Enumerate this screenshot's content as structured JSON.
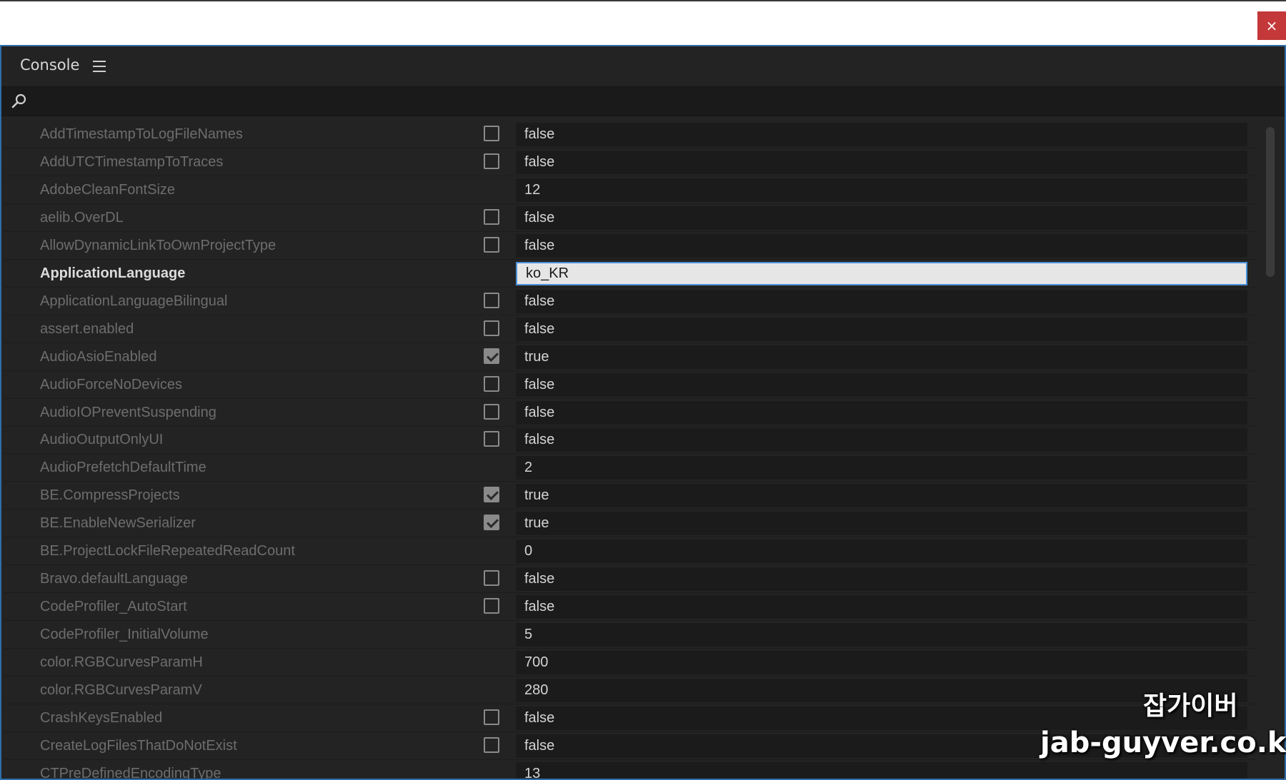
{
  "window": {
    "close_label": "×"
  },
  "panel": {
    "title": "Console"
  },
  "search": {
    "placeholder": ""
  },
  "rows": [
    {
      "name": "AddTimestampToLogFileNames",
      "checkbox": "unchecked",
      "value": "false"
    },
    {
      "name": "AddUTCTimestampToTraces",
      "checkbox": "unchecked",
      "value": "false"
    },
    {
      "name": "AdobeCleanFontSize",
      "checkbox": "none",
      "value": "12"
    },
    {
      "name": "aelib.OverDL",
      "checkbox": "unchecked",
      "value": "false"
    },
    {
      "name": "AllowDynamicLinkToOwnProjectType",
      "checkbox": "unchecked",
      "value": "false"
    },
    {
      "name": "ApplicationLanguage",
      "checkbox": "none",
      "value": "ko_KR",
      "active": true
    },
    {
      "name": "ApplicationLanguageBilingual",
      "checkbox": "unchecked",
      "value": "false"
    },
    {
      "name": "assert.enabled",
      "checkbox": "unchecked",
      "value": "false"
    },
    {
      "name": "AudioAsioEnabled",
      "checkbox": "checked",
      "value": "true"
    },
    {
      "name": "AudioForceNoDevices",
      "checkbox": "unchecked",
      "value": "false"
    },
    {
      "name": "AudioIOPreventSuspending",
      "checkbox": "unchecked",
      "value": "false"
    },
    {
      "name": "AudioOutputOnlyUI",
      "checkbox": "unchecked",
      "value": "false"
    },
    {
      "name": "AudioPrefetchDefaultTime",
      "checkbox": "none",
      "value": "2"
    },
    {
      "name": "BE.CompressProjects",
      "checkbox": "checked",
      "value": "true"
    },
    {
      "name": "BE.EnableNewSerializer",
      "checkbox": "checked",
      "value": "true"
    },
    {
      "name": "BE.ProjectLockFileRepeatedReadCount",
      "checkbox": "none",
      "value": "0"
    },
    {
      "name": "Bravo.defaultLanguage",
      "checkbox": "unchecked",
      "value": "false"
    },
    {
      "name": "CodeProfiler_AutoStart",
      "checkbox": "unchecked",
      "value": "false"
    },
    {
      "name": "CodeProfiler_InitialVolume",
      "checkbox": "none",
      "value": "5"
    },
    {
      "name": "color.RGBCurvesParamH",
      "checkbox": "none",
      "value": "700"
    },
    {
      "name": "color.RGBCurvesParamV",
      "checkbox": "none",
      "value": "280"
    },
    {
      "name": "CrashKeysEnabled",
      "checkbox": "unchecked",
      "value": "false"
    },
    {
      "name": "CreateLogFilesThatDoNotExist",
      "checkbox": "unchecked",
      "value": "false"
    },
    {
      "name": "CTPreDefinedEncodingType",
      "checkbox": "none",
      "value": "13"
    }
  ],
  "watermark": {
    "korean": "잡가이버",
    "url": "jab-guyver.co.kr"
  }
}
